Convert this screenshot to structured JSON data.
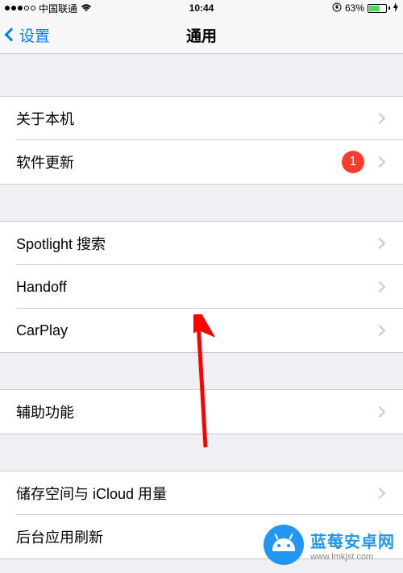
{
  "status": {
    "carrier": "中国联通",
    "time": "10:44",
    "battery_percent": "63%"
  },
  "nav": {
    "back_label": "设置",
    "title": "通用"
  },
  "groups": [
    {
      "rows": [
        {
          "label": "关于本机",
          "badge": null
        },
        {
          "label": "软件更新",
          "badge": "1"
        }
      ]
    },
    {
      "rows": [
        {
          "label": "Spotlight 搜索",
          "badge": null
        },
        {
          "label": "Handoff",
          "badge": null
        },
        {
          "label": "CarPlay",
          "badge": null
        }
      ]
    },
    {
      "rows": [
        {
          "label": "辅助功能",
          "badge": null
        }
      ]
    },
    {
      "rows": [
        {
          "label": "储存空间与 iCloud 用量",
          "badge": null
        },
        {
          "label": "后台应用刷新",
          "badge": null
        }
      ]
    }
  ],
  "watermark": {
    "title": "蓝莓安卓网",
    "url": "www.lmkjst.com"
  }
}
